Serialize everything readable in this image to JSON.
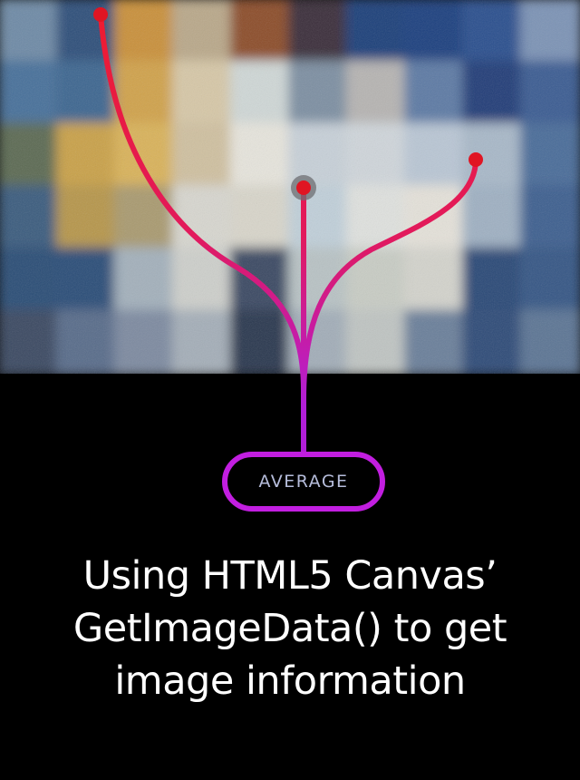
{
  "badge": {
    "label": "AVERAGE"
  },
  "caption": {
    "lines": [
      "Using HTML5 Canvas’",
      "GetImageData() to get",
      "image information"
    ]
  },
  "colors": {
    "background": "#000000",
    "curve_top": "#ee1c2e",
    "curve_bottom": "#b21ed8",
    "badge_border": "#c21ee0",
    "badge_text": "#b6bddb",
    "caption_text": "#ffffff"
  }
}
